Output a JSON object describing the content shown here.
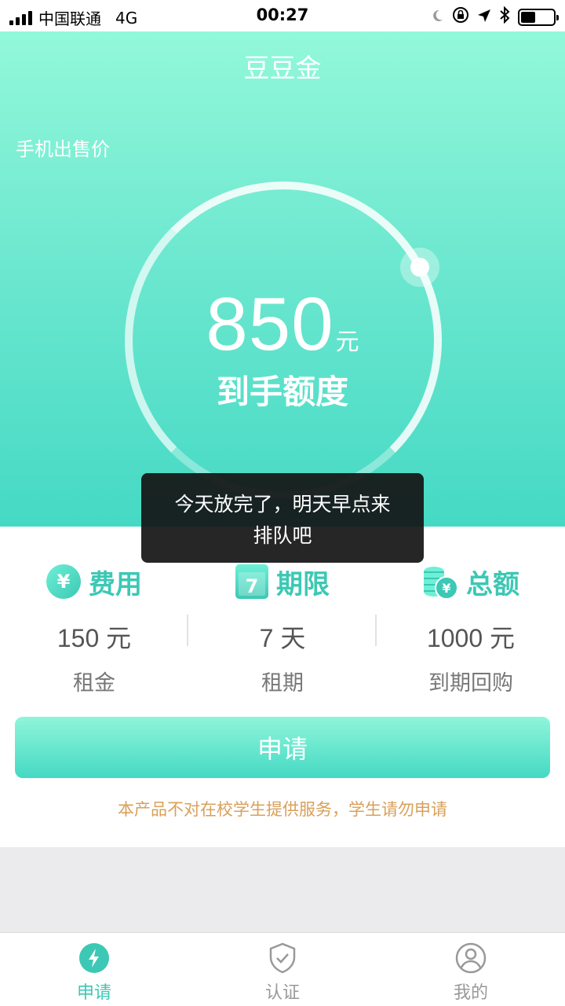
{
  "status_bar": {
    "carrier": "中国联通",
    "network": "4G",
    "time": "00:27"
  },
  "hero": {
    "title": "豆豆金",
    "subtitle": "手机出售价",
    "amount": "850",
    "amount_unit": "元",
    "amount_label": "到手额度"
  },
  "info": {
    "fee": {
      "title": "费用",
      "value": "150 元",
      "sub": "租金",
      "icon": "yen-icon"
    },
    "term": {
      "title": "期限",
      "value": "7 天",
      "sub": "租期",
      "icon": "calendar-icon",
      "icon_text": "7"
    },
    "total": {
      "title": "总额",
      "value": "1000 元",
      "sub": "到期回购",
      "icon": "coins-icon"
    },
    "apply_label": "申请",
    "notice": "本产品不对在校学生提供服务，学生请勿申请"
  },
  "toast": {
    "line1": "今天放完了，明天早点来",
    "line2": "排队吧"
  },
  "tabbar": {
    "tabs": [
      {
        "label": "申请",
        "icon": "lightning-icon",
        "active": true
      },
      {
        "label": "认证",
        "icon": "shield-check-icon",
        "active": false
      },
      {
        "label": "我的",
        "icon": "user-icon",
        "active": false
      }
    ]
  },
  "colors": {
    "accent": "#3cc8b4",
    "hero_top": "#93f8da",
    "hero_bottom": "#45d9c4",
    "notice": "#d9a05a"
  }
}
